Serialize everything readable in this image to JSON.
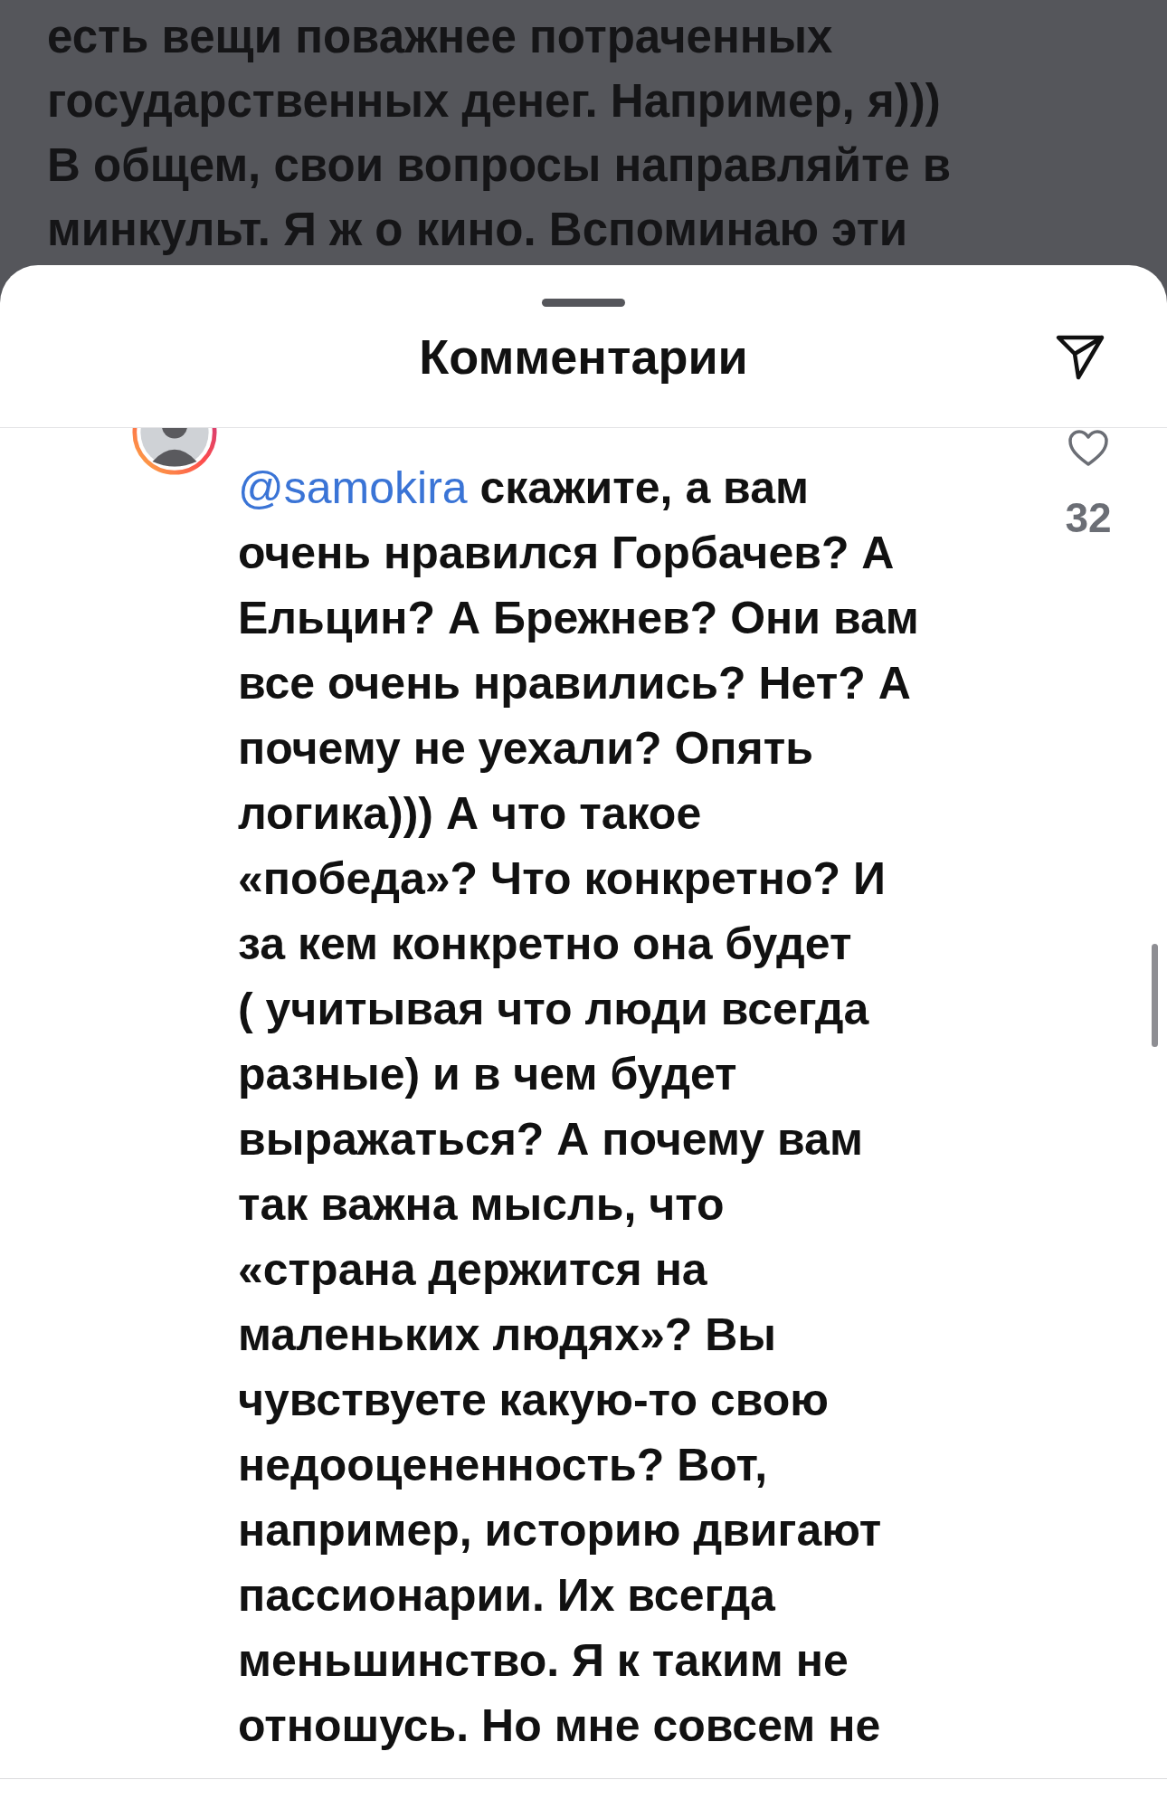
{
  "background_post": {
    "lines": [
      "есть вещи поважнее потраченных",
      "государственных денег. Например, я)))",
      "В общем, свои вопросы направляйте в",
      "минкульт. Я ж о кино. Вспоминаю эти"
    ]
  },
  "sheet": {
    "title": "Комментарии"
  },
  "comment": {
    "mention": "@samokira",
    "like_count": "32",
    "lines": [
      "скажите, а вам",
      "очень нравился Горбачев? А",
      "Ельцин? А Брежнев? Они вам",
      "все очень нравились? Нет? А",
      "почему не уехали? Опять",
      "логика))) А что такое",
      "«победа»? Что конкретно? И",
      "за кем конкретно она будет",
      "( учитывая что люди всегда",
      "разные) и в чем будет",
      "выражаться? А почему вам",
      "так важна мысль, что",
      "«страна держится на",
      "маленьких людях»? Вы",
      "чувствуете какую-то свою",
      "недооцененность? Вот,",
      "например, историю двигают",
      "пассионарии. Их всегда",
      "меньшинство. Я к таким не",
      "отношусь. Но мне совсем не"
    ]
  }
}
